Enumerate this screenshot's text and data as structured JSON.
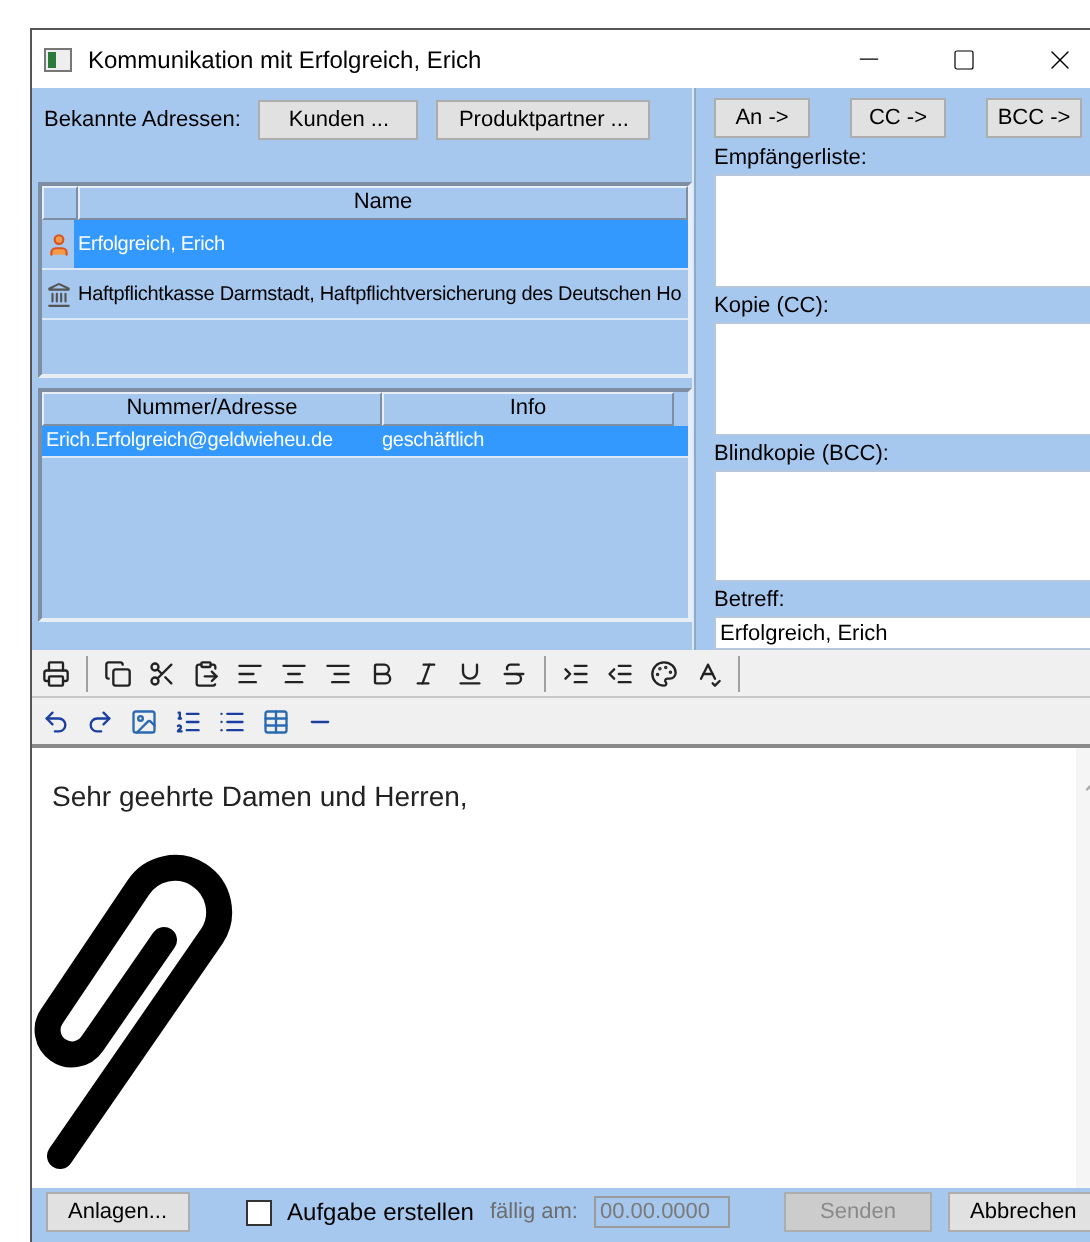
{
  "window": {
    "title": "Kommunikation mit Erfolgreich, Erich"
  },
  "known_addresses": {
    "label": "Bekannte Adressen:",
    "buttons": [
      "Kunden ...",
      "Produktpartner ..."
    ]
  },
  "contacts": {
    "columns": [
      "Name"
    ],
    "rows": [
      {
        "name": "Erfolgreich, Erich",
        "kind": "person",
        "selected": true
      },
      {
        "name": "Haftpflichtkasse Darmstadt, Haftpflichtversicherung des Deutschen Ho",
        "kind": "organization",
        "selected": false
      }
    ]
  },
  "addresses": {
    "columns": [
      "Nummer/Adresse",
      "Info"
    ],
    "rows": [
      {
        "address": "Erich.Erfolgreich@geldwieheu.de",
        "info": "geschäftlich",
        "selected": true
      }
    ]
  },
  "recipient_buttons": [
    "An ->",
    "CC ->",
    "BCC ->"
  ],
  "fields": [
    {
      "kind": "list",
      "label": "Empfängerliste:"
    },
    {
      "kind": "list",
      "label": "Kopie (CC):"
    },
    {
      "kind": "list",
      "label": "Blindkopie (BCC):"
    },
    {
      "kind": "text",
      "label": "Betreff:",
      "value": "Erfolgreich, Erich"
    }
  ],
  "editor": {
    "text": "Sehr geehrte Damen und Herren,"
  },
  "footer": {
    "attachments_button": "Anlagen...",
    "task": {
      "label": "Aufgabe erstellen",
      "checked": false
    },
    "due": {
      "label": "fällig am:",
      "value": "00.00.0000",
      "disabled": true
    },
    "buttons": [
      {
        "label": "Senden",
        "disabled": true
      },
      {
        "label": "Abbrechen",
        "disabled": false
      }
    ]
  }
}
